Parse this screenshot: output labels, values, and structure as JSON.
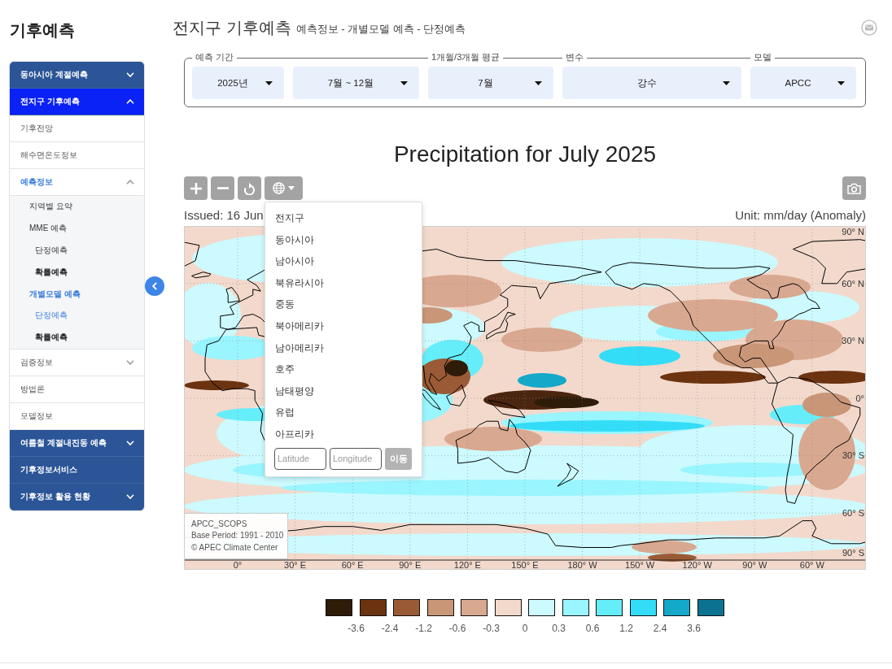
{
  "sidebar": {
    "title": "기후예측",
    "items": [
      {
        "label": "동아시아 계절예측",
        "selected": false,
        "expanded": false
      },
      {
        "label": "전지구 기후예측",
        "selected": true,
        "expanded": true,
        "children": [
          {
            "label": "기후전망",
            "selected": false
          },
          {
            "label": "해수면온도정보",
            "selected": false
          },
          {
            "label": "예측정보",
            "selected": true,
            "expanded": true,
            "children": [
              {
                "label": "지역별 요약",
                "selected": false
              },
              {
                "label": "MME 예측",
                "selected": false,
                "children": [
                  {
                    "label": "단정예측",
                    "selected": false,
                    "bold": false
                  },
                  {
                    "label": "확률예측",
                    "selected": false,
                    "bold": true
                  }
                ]
              },
              {
                "label": "개별모델 예측",
                "selected": true,
                "children": [
                  {
                    "label": "단정예측",
                    "selected": true,
                    "bold": false
                  },
                  {
                    "label": "확률예측",
                    "selected": false,
                    "bold": true
                  }
                ]
              }
            ]
          },
          {
            "label": "검증정보",
            "selected": false,
            "expanded": false
          },
          {
            "label": "방법론",
            "selected": false
          },
          {
            "label": "모델정보",
            "selected": false
          }
        ]
      },
      {
        "label": "여름철 계절내진동 예측",
        "selected": false,
        "expanded": false
      },
      {
        "label": "기후정보서비스",
        "selected": false
      },
      {
        "label": "기후정보 활용 현황",
        "selected": false,
        "expanded": false
      }
    ]
  },
  "header": {
    "title": "전지구 기후예측",
    "breadcrumb": "예측정보 - 개별모델 예측 - 단정예측"
  },
  "filters": [
    {
      "label": "예측 기간",
      "selects": [
        "2025년",
        "7월 ~ 12월"
      ]
    },
    {
      "label": "1개월/3개월 평균",
      "selects": [
        "7월"
      ]
    },
    {
      "label": "변수",
      "selects": [
        "강수"
      ]
    },
    {
      "label": "모델",
      "selects": [
        "APCC"
      ]
    }
  ],
  "chart": {
    "title": "Precipitation for July 2025",
    "issued": "Issued: 16 Jun",
    "unit": "Unit: mm/day (Anomaly)",
    "latitude_labels": [
      "90° N",
      "60° N",
      "30° N",
      "0°",
      "30° S",
      "60° S",
      "90° S"
    ],
    "longitude_labels": [
      "0°",
      "30° E",
      "60° E",
      "90° E",
      "120° E",
      "150° E",
      "180° W",
      "150° W",
      "120° W",
      "90° W",
      "60° W"
    ],
    "credits": [
      "APCC_SCOPS",
      "Base Period: 1991 - 2010",
      "© APEC Climate Center"
    ]
  },
  "region_menu": {
    "items": [
      "전지구",
      "동아시아",
      "남아시아",
      "북유라시아",
      "중동",
      "북아메리카",
      "남아메리카",
      "호주",
      "남태평양",
      "유럽",
      "아프리카"
    ],
    "latitude_placeholder": "Latitude",
    "longitude_placeholder": "Longitude",
    "go_button": "이동"
  },
  "legend": {
    "swatches": [
      {
        "color": "#2e1b08"
      },
      {
        "color": "#6b3310"
      },
      {
        "color": "#9a5a36"
      },
      {
        "color": "#c99678"
      },
      {
        "color": "#d9a890"
      },
      {
        "color": "#f2d9cc"
      },
      {
        "color": "#ccfaff"
      },
      {
        "color": "#99f5ff"
      },
      {
        "color": "#66edfa"
      },
      {
        "color": "#33ddf7"
      },
      {
        "color": "#14a8c9"
      },
      {
        "color": "#0b7391"
      }
    ],
    "labels": [
      "-3.6",
      "-2.4",
      "-1.2",
      "-0.6",
      "-0.3",
      "0",
      "0.3",
      "0.6",
      "1.2",
      "2.4",
      "3.6"
    ]
  }
}
